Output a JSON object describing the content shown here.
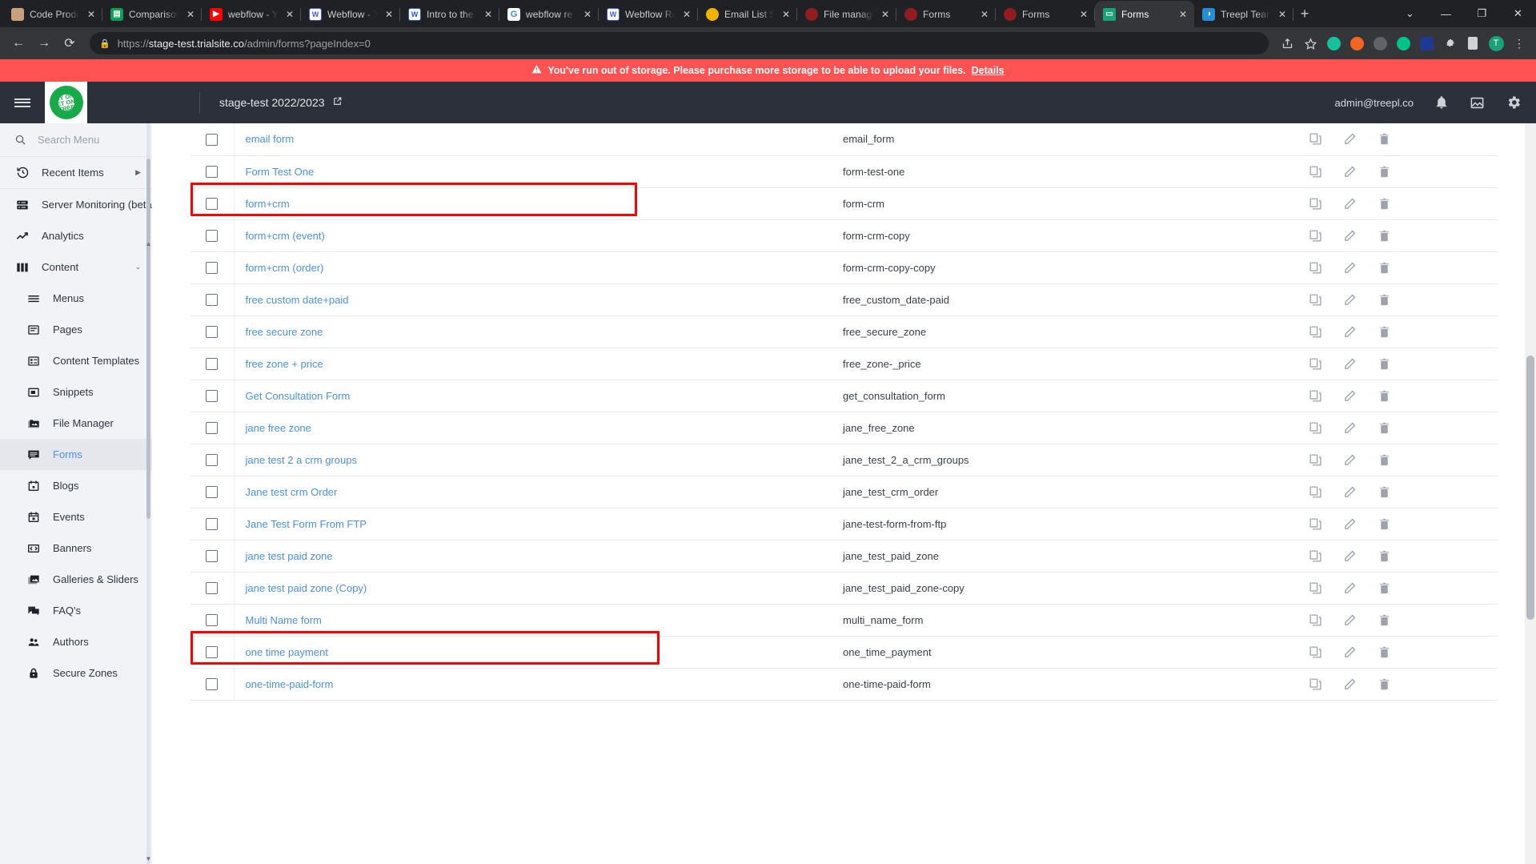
{
  "browser": {
    "tabs": [
      {
        "label": "Code Produ",
        "favicon": "book-icon",
        "color": "#c7a27c",
        "active": false
      },
      {
        "label": "Comparison",
        "favicon": "sheets-icon",
        "color": "#0f9d58",
        "active": false
      },
      {
        "label": "webflow - Y",
        "favicon": "youtube-icon",
        "color": "#ff0000",
        "active": false
      },
      {
        "label": "Webflow - T",
        "favicon": "webflow-icon",
        "color": "#4353ff",
        "active": false
      },
      {
        "label": "Intro to the",
        "favicon": "webflow-icon",
        "color": "#2453ff",
        "active": false
      },
      {
        "label": "webflow re",
        "favicon": "google-icon",
        "color": "#4285f4",
        "active": false
      },
      {
        "label": "Webflow Re",
        "favicon": "webflow-icon",
        "color": "#4353ff",
        "active": false
      },
      {
        "label": "Email List S",
        "favicon": "gear-orange-icon",
        "color": "#f0b400",
        "active": false
      },
      {
        "label": "File manage",
        "favicon": "treepl-icon",
        "color": "#8f1d22",
        "active": false
      },
      {
        "label": "Forms",
        "favicon": "treepl-icon",
        "color": "#8f1d22",
        "active": false
      },
      {
        "label": "Forms",
        "favicon": "treepl-icon",
        "color": "#8f1d22",
        "active": false
      },
      {
        "label": "Forms",
        "favicon": "monitor-icon",
        "color": "#1aa179",
        "active": true
      },
      {
        "label": "Treepl Team",
        "favicon": "teams-icon",
        "color": "#2a8cd4",
        "active": false
      }
    ],
    "new_tab_label": "+",
    "window_controls": {
      "tab_search": "⌄",
      "minimize": "—",
      "maximize": "❐",
      "close": "✕"
    },
    "nav": {
      "back": "←",
      "forward": "→",
      "reload": "⟳"
    },
    "url": {
      "lock_icon": "lock-icon",
      "scheme": "https://",
      "host": "stage-test.trialsite.co",
      "path": "/admin/forms?pageIndex=0"
    },
    "omni_icons": [
      "share-icon",
      "bookmark-star-icon",
      "grammarly-icon",
      "extension-orange-icon",
      "recycle-icon",
      "bird-icon",
      "shield-icon",
      "puzzle-icon",
      "tab-icon"
    ],
    "profile_initial": "T",
    "menu_icon": "kebab-menu-icon"
  },
  "alert": {
    "warn_icon": "warning-triangle-icon",
    "message": "You've run out of storage. Please purchase more storage to be able to upload your files.",
    "link_label": "Details",
    "bg_color": "#ff5252"
  },
  "header": {
    "menu_icon": "hamburger-icon",
    "logo_line1": "BUY ONE",
    "logo_line2": "GET ONE",
    "logo_line3": "FREE",
    "site_name": "stage-test 2022/2023",
    "open_site_icon": "external-link-icon",
    "user_email": "admin@treepl.co",
    "notification_icon": "bell-icon",
    "gallery_icon": "image-icon",
    "settings_icon": "gear-icon",
    "bg_color": "#2b303b"
  },
  "sidebar": {
    "search_placeholder": "Search Menu",
    "search_value": "",
    "search_icon": "search-icon",
    "recent": {
      "label": "Recent Items",
      "icon": "history-icon",
      "caret": "▶"
    },
    "items": [
      {
        "label": "Server Monitoring (beta)",
        "icon": "server-icon",
        "sub": false,
        "active": false
      },
      {
        "label": "Analytics",
        "icon": "trending-up-icon",
        "sub": false,
        "active": false
      },
      {
        "label": "Content",
        "icon": "columns-icon",
        "sub": false,
        "active": false,
        "caret": "⌄"
      },
      {
        "label": "Menus",
        "icon": "menu-lines-icon",
        "sub": true,
        "active": false
      },
      {
        "label": "Pages",
        "icon": "page-icon",
        "sub": true,
        "active": false
      },
      {
        "label": "Content Templates",
        "icon": "template-icon",
        "sub": true,
        "active": false
      },
      {
        "label": "Snippets",
        "icon": "snippet-icon",
        "sub": true,
        "active": false
      },
      {
        "label": "File Manager",
        "icon": "file-manager-icon",
        "sub": true,
        "active": false
      },
      {
        "label": "Forms",
        "icon": "forms-icon",
        "sub": true,
        "active": true
      },
      {
        "label": "Blogs",
        "icon": "blog-icon",
        "sub": true,
        "active": false
      },
      {
        "label": "Events",
        "icon": "event-icon",
        "sub": true,
        "active": false
      },
      {
        "label": "Banners",
        "icon": "banner-icon",
        "sub": true,
        "active": false
      },
      {
        "label": "Galleries & Sliders",
        "icon": "gallery-icon",
        "sub": true,
        "active": false
      },
      {
        "label": "FAQ's",
        "icon": "faq-icon",
        "sub": true,
        "active": false
      },
      {
        "label": "Authors",
        "icon": "authors-icon",
        "sub": true,
        "active": false
      },
      {
        "label": "Secure Zones",
        "icon": "lock-icon",
        "sub": true,
        "active": false
      }
    ]
  },
  "table": {
    "row_action_icons": [
      "copy-icon",
      "edit-pencil-icon",
      "delete-trash-icon"
    ],
    "highlight_color": "#ff0000",
    "rows": [
      {
        "name": "email form",
        "slug": "email_form",
        "checked": false,
        "highlighted": false
      },
      {
        "name": "Form Test One",
        "slug": "form-test-one",
        "checked": false,
        "highlighted": true
      },
      {
        "name": "form+crm",
        "slug": "form-crm",
        "checked": false,
        "highlighted": false
      },
      {
        "name": "form+crm (event)",
        "slug": "form-crm-copy",
        "checked": false,
        "highlighted": false
      },
      {
        "name": "form+crm (order)",
        "slug": "form-crm-copy-copy",
        "checked": false,
        "highlighted": false
      },
      {
        "name": "free custom date+paid",
        "slug": "free_custom_date-paid",
        "checked": false,
        "highlighted": false
      },
      {
        "name": "free secure zone",
        "slug": "free_secure_zone",
        "checked": false,
        "highlighted": false
      },
      {
        "name": "free zone + price",
        "slug": "free_zone-_price",
        "checked": false,
        "highlighted": false
      },
      {
        "name": "Get Consultation Form",
        "slug": "get_consultation_form",
        "checked": false,
        "highlighted": false
      },
      {
        "name": "jane free zone",
        "slug": "jane_free_zone",
        "checked": false,
        "highlighted": false
      },
      {
        "name": "jane test 2 a crm groups",
        "slug": "jane_test_2_a_crm_groups",
        "checked": false,
        "highlighted": false
      },
      {
        "name": "Jane test crm Order",
        "slug": "jane_test_crm_order",
        "checked": false,
        "highlighted": false
      },
      {
        "name": "Jane Test Form From FTP",
        "slug": "jane-test-form-from-ftp",
        "checked": false,
        "highlighted": false
      },
      {
        "name": "jane test paid zone",
        "slug": "jane_test_paid_zone",
        "checked": false,
        "highlighted": false
      },
      {
        "name": "jane test paid zone (Copy)",
        "slug": "jane_test_paid_zone-copy",
        "checked": false,
        "highlighted": true,
        "highlight_wide": true
      },
      {
        "name": "Multi Name form",
        "slug": "multi_name_form",
        "checked": false,
        "highlighted": false
      },
      {
        "name": "one time payment",
        "slug": "one_time_payment",
        "checked": false,
        "highlighted": false
      },
      {
        "name": "one-time-paid-form",
        "slug": "one-time-paid-form",
        "checked": false,
        "highlighted": false
      }
    ]
  }
}
